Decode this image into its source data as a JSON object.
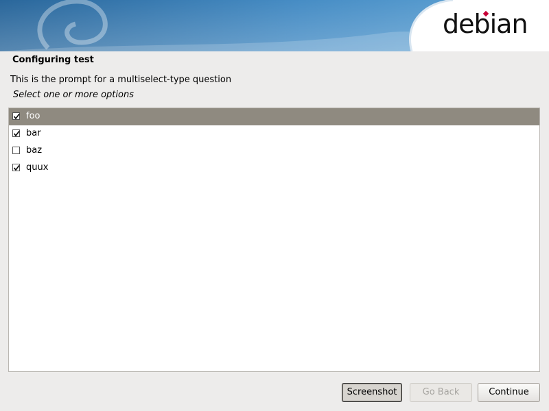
{
  "banner": {
    "logo_text": "debian",
    "brand_accent": "#c70036",
    "sky_color": "#2a74b0"
  },
  "page": {
    "title": "Configuring test",
    "prompt": "This is the prompt for a multiselect-type question",
    "hint": "Select one or more options"
  },
  "options": [
    {
      "label": "foo",
      "checked": true,
      "selected": true
    },
    {
      "label": "bar",
      "checked": true,
      "selected": false
    },
    {
      "label": "baz",
      "checked": false,
      "selected": false
    },
    {
      "label": "quux",
      "checked": true,
      "selected": false
    }
  ],
  "buttons": {
    "screenshot": "Screenshot",
    "go_back": "Go Back",
    "continue": "Continue",
    "go_back_enabled": false
  }
}
